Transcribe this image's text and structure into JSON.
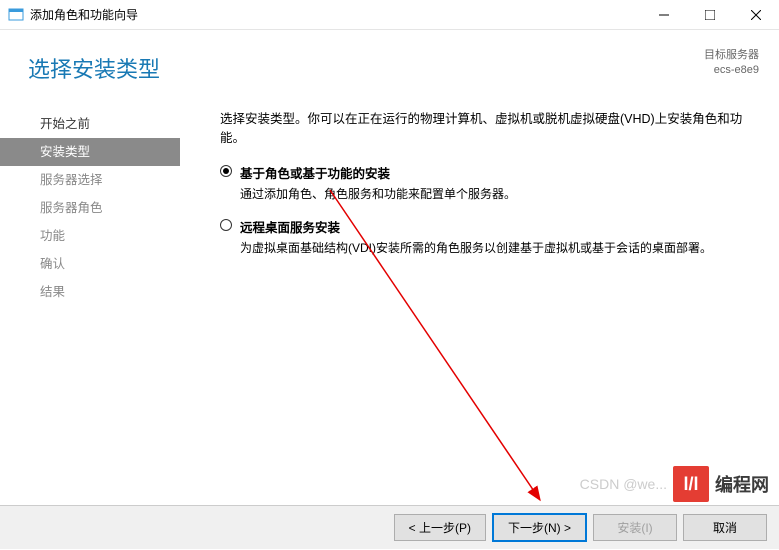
{
  "titlebar": {
    "title": "添加角色和功能向导"
  },
  "header": {
    "page_title": "选择安装类型",
    "target_label": "目标服务器",
    "target_value": "ecs-e8e9"
  },
  "sidebar": {
    "items": [
      {
        "label": "开始之前",
        "state": "completed"
      },
      {
        "label": "安装类型",
        "state": "active"
      },
      {
        "label": "服务器选择",
        "state": "pending"
      },
      {
        "label": "服务器角色",
        "state": "pending"
      },
      {
        "label": "功能",
        "state": "pending"
      },
      {
        "label": "确认",
        "state": "pending"
      },
      {
        "label": "结果",
        "state": "pending"
      }
    ]
  },
  "content": {
    "instruction": "选择安装类型。你可以在正在运行的物理计算机、虚拟机或脱机虚拟硬盘(VHD)上安装角色和功能。",
    "options": [
      {
        "label": "基于角色或基于功能的安装",
        "desc": "通过添加角色、角色服务和功能来配置单个服务器。",
        "checked": true
      },
      {
        "label": "远程桌面服务安装",
        "desc": "为虚拟桌面基础结构(VDI)安装所需的角色服务以创建基于虚拟机或基于会话的桌面部署。",
        "checked": false
      }
    ]
  },
  "footer": {
    "prev": "< 上一步(P)",
    "next": "下一步(N) >",
    "install": "安装(I)",
    "cancel": "取消"
  },
  "watermark": {
    "csdn": "CSDN @we...",
    "brand": "编程网"
  }
}
